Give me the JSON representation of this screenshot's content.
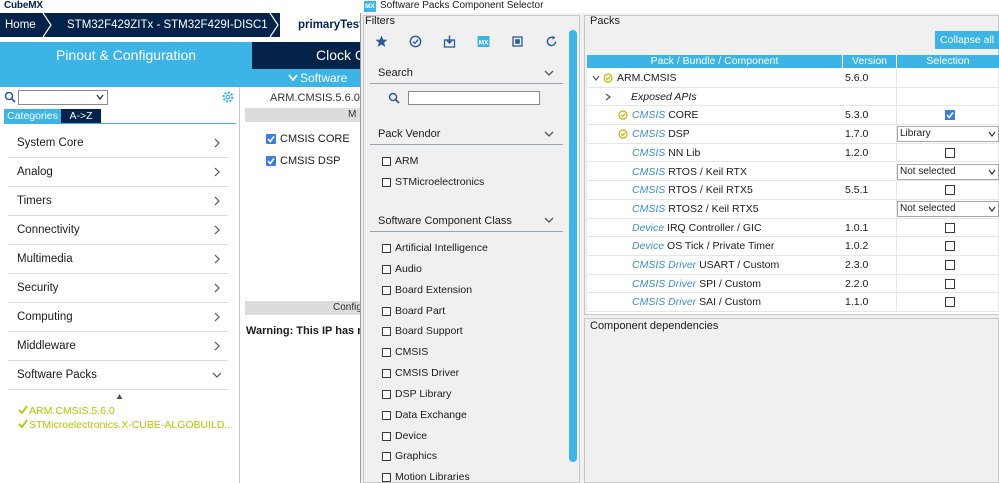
{
  "app": {
    "logo": "CubeMX",
    "breadcrumb": [
      "Home",
      "STM32F429ZITx  -  STM32F429I-DISC1",
      "primaryTest"
    ],
    "tabs": {
      "pinout": "Pinout & Configuration",
      "clock": "Clock C"
    },
    "software_strip": "Software",
    "categories_tab": "Categories",
    "az_tab": "A->Z",
    "categories": [
      "System Core",
      "Analog",
      "Timers",
      "Connectivity",
      "Multimedia",
      "Security",
      "Computing",
      "Middleware",
      "Software Packs"
    ],
    "selected_packs": [
      "ARM.CMSIS.5.6.0",
      "STMicroelectronics.X-CUBE-ALGOBUILD..."
    ],
    "mid": {
      "title": "ARM.CMSIS.5.6.0 M",
      "bar1": "M",
      "checks": [
        "CMSIS CORE",
        "CMSIS DSP"
      ],
      "bar2": "Config",
      "warning": "Warning: This IP has no"
    }
  },
  "dialog": {
    "title": "Software Packs Component Selector",
    "app_icon": "MX",
    "filters": {
      "label": "Filters",
      "search_label": "Search",
      "search_value": "",
      "pack_vendor_label": "Pack Vendor",
      "vendors": [
        "ARM",
        "STMicroelectronics"
      ],
      "component_class_label": "Software Component Class",
      "classes": [
        "Artificial Intelligence",
        "Audio",
        "Board Extension",
        "Board Part",
        "Board Support",
        "CMSIS",
        "CMSIS Driver",
        "DSP Library",
        "Data Exchange",
        "Device",
        "Graphics",
        "Motion Libraries"
      ]
    },
    "packs": {
      "label": "Packs",
      "collapse_all": "Collapse all",
      "columns": [
        "Pack / Bundle / Component",
        "Version",
        "Selection"
      ],
      "rows": [
        {
          "prefix": "",
          "name": "ARM.CMSIS",
          "version": "5.6.0",
          "selection": ""
        },
        {
          "prefix": "",
          "name": "Exposed APIs",
          "version": "",
          "selection": ""
        },
        {
          "prefix": "CMSIS",
          "name": "CORE",
          "version": "5.3.0",
          "selection": "checked"
        },
        {
          "prefix": "CMSIS",
          "name": "DSP",
          "version": "1.7.0",
          "selection": "Library"
        },
        {
          "prefix": "CMSIS",
          "name": "NN Lib",
          "version": "1.2.0",
          "selection": "unchecked"
        },
        {
          "prefix": "CMSIS",
          "name": "RTOS / Keil RTX",
          "version": "",
          "selection": "Not selected"
        },
        {
          "prefix": "CMSIS",
          "name": "RTOS / Keil RTX5",
          "version": "5.5.1",
          "selection": "unchecked"
        },
        {
          "prefix": "CMSIS",
          "name": "RTOS2 / Keil RTX5",
          "version": "",
          "selection": "Not selected"
        },
        {
          "prefix": "Device",
          "name": "IRQ Controller / GIC",
          "version": "1.0.1",
          "selection": "unchecked"
        },
        {
          "prefix": "Device",
          "name": "OS Tick / Private Timer",
          "version": "1.0.2",
          "selection": "unchecked"
        },
        {
          "prefix": "CMSIS Driver",
          "name": "USART / Custom",
          "version": "2.3.0",
          "selection": "unchecked"
        },
        {
          "prefix": "CMSIS Driver",
          "name": "SPI / Custom",
          "version": "2.2.0",
          "selection": "unchecked"
        },
        {
          "prefix": "CMSIS Driver",
          "name": "SAI / Custom",
          "version": "1.1.0",
          "selection": "unchecked"
        }
      ]
    },
    "deps_label": "Component dependencies"
  },
  "colors": {
    "accent": "#3cb4e6",
    "navy": "#03234b",
    "ok": "#b0c800",
    "check": "#3c7fd8"
  }
}
